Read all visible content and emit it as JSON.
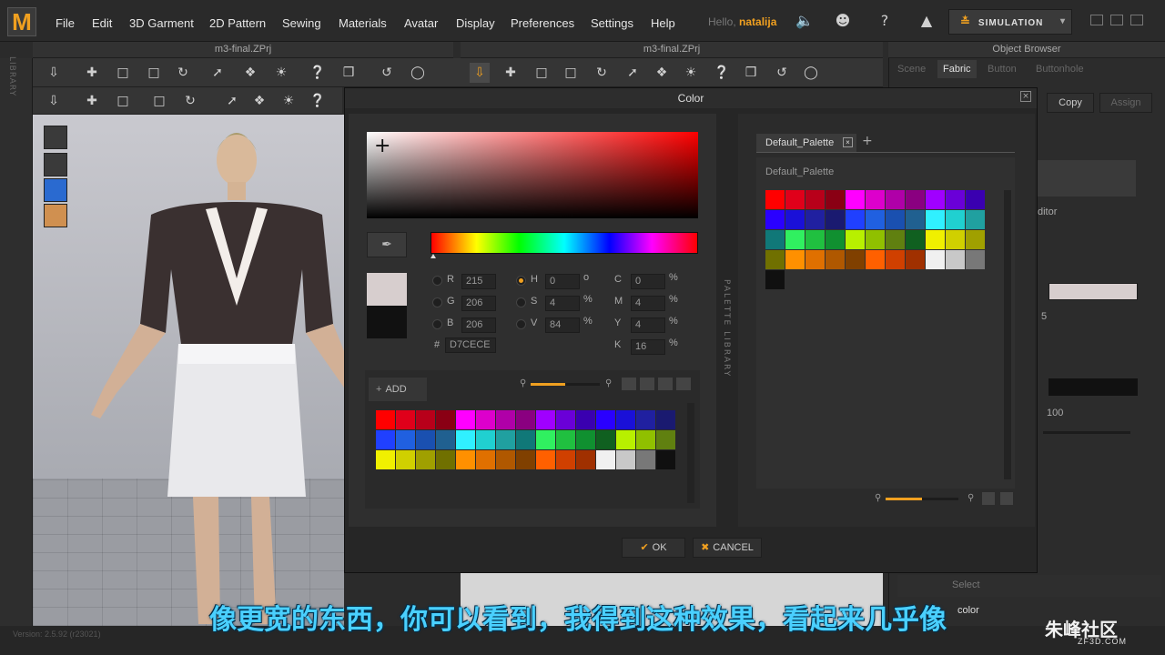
{
  "app": {
    "logo": "M"
  },
  "menu": [
    "File",
    "Edit",
    "3D Garment",
    "2D Pattern",
    "Sewing",
    "Materials",
    "Avatar",
    "Display",
    "Preferences",
    "Settings",
    "Help"
  ],
  "user": {
    "hello": "Hello,",
    "name": "natalija"
  },
  "simulation_label": "SIMULATION",
  "panels": {
    "left_tab": "m3-final.ZPrj",
    "mid_tab": "m3-final.ZPrj",
    "object_browser": "Object Browser",
    "library_label": "LIBRARY"
  },
  "object_browser": {
    "tabs": [
      "Scene",
      "Fabric",
      "Button",
      "Buttonhole"
    ],
    "active_tab": "Fabric",
    "copy_label": "Copy",
    "assign_label": "Assign",
    "editor_label": "ditor",
    "value_5": "5",
    "value_100": "100",
    "select_label": "Select",
    "color_label": "color",
    "swatch_color": "#d7cece",
    "dark_swatch": "#111111"
  },
  "dialog": {
    "title": "Color",
    "rgb": {
      "r_label": "R",
      "g_label": "G",
      "b_label": "B",
      "r": "215",
      "g": "206",
      "b": "206"
    },
    "hsv": {
      "h_label": "H",
      "s_label": "S",
      "v_label": "V",
      "h": "0",
      "s": "4",
      "v": "84",
      "h_unit": "o",
      "s_unit": "%",
      "v_unit": "%"
    },
    "cmyk": {
      "c_label": "C",
      "m_label": "M",
      "y_label": "Y",
      "k_label": "K",
      "c": "0",
      "m": "4",
      "y": "4",
      "k": "16",
      "unit": "%"
    },
    "hex_label": "#",
    "hex": "D7CECE",
    "new_color": "#d7cece",
    "old_color": "#111111",
    "add_label": "ADD",
    "palette_library_label": "PALETTE LIBRARY",
    "palette_tab": "Default_Palette",
    "palette_name": "Default_Palette",
    "ok_label": "OK",
    "cancel_label": "CANCEL",
    "left_swatches": [
      "#ff0000",
      "#e0001a",
      "#b8001a",
      "#8a0014",
      "#ff00ff",
      "#dd00cc",
      "#b000a8",
      "#8a0080",
      "#a000ff",
      "#6a00d8",
      "#3a00b0",
      "#2a00ff",
      "#1a10d8",
      "#2020a0",
      "#1a1a70",
      "#2040ff",
      "#2060e0",
      "#1a50b0",
      "#206090",
      "#30f0ff",
      "#20d0d0",
      "#20a0a0",
      "#107878",
      "#30f060",
      "#20c040",
      "#109030",
      "#106020",
      "#b8f000",
      "#90c000",
      "#608010",
      "#f0f000",
      "#d0d000",
      "#a0a000",
      "#707000",
      "#ff9000",
      "#e07000",
      "#b05800",
      "#804000",
      "#ff6000",
      "#d04000",
      "#a03000",
      "#f0f0f0",
      "#c8c8c8",
      "#787878",
      "#101010"
    ],
    "right_swatches": [
      "#ff0000",
      "#e0001a",
      "#b8001a",
      "#8a0014",
      "#ff00ff",
      "#dd00cc",
      "#b000a8",
      "#8a0080",
      "#a000ff",
      "#6a00d8",
      "#3a00b0",
      "#2a00ff",
      "#1a10d8",
      "#2020a0",
      "#1a1a70",
      "#2040ff",
      "#2060e0",
      "#1a50b0",
      "#206090",
      "#30f0ff",
      "#20d0d0",
      "#20a0a0",
      "#107878",
      "#30f060",
      "#20c040",
      "#109030",
      "#b8f000",
      "#90c000",
      "#608010",
      "#106020",
      "#f0f000",
      "#d0d000",
      "#a0a000",
      "#707000",
      "#ff9000",
      "#e07000",
      "#b05800",
      "#804000",
      "#ff6000",
      "#d04000",
      "#a03000",
      "#f0f0f0",
      "#c8c8c8",
      "#787878",
      "#101010"
    ]
  },
  "version": "Version: 2.5.92   (r23021)",
  "subtitle": "像更宽的东西，你可以看到，我得到这种效果，看起来几乎像",
  "watermark": {
    "brand": "朱峰社区",
    "url": "ZF3D.COM"
  },
  "colors": {
    "accent": "#f0a020",
    "subtitle": "#4ad0ff"
  }
}
